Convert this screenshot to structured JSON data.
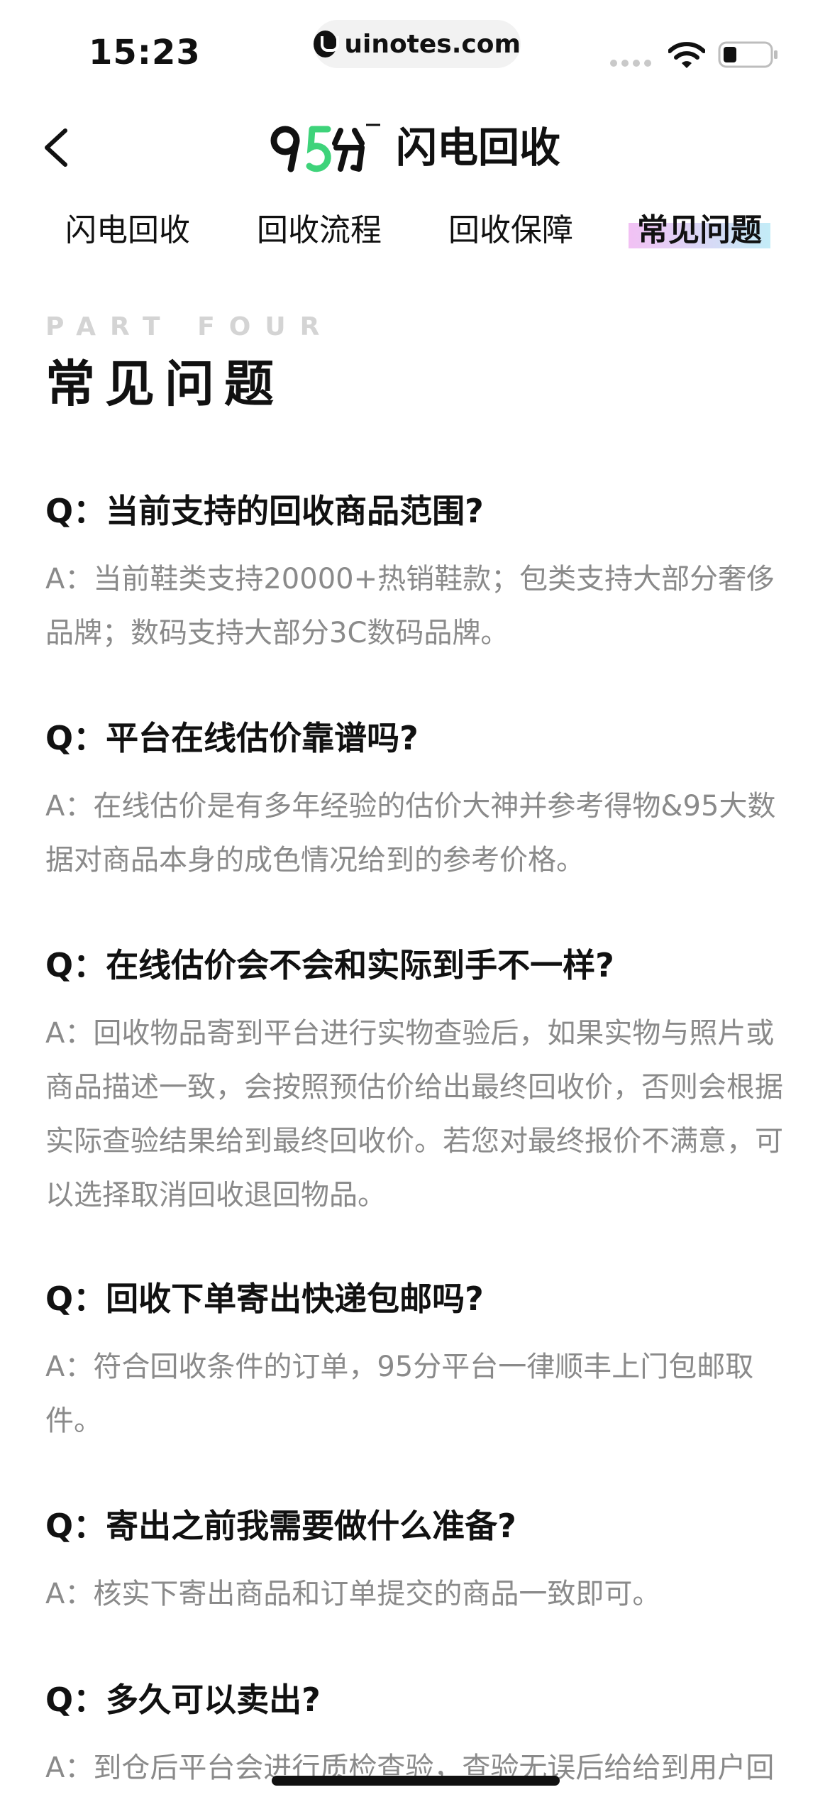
{
  "status": {
    "time": "15:23",
    "url": "uinotes.com"
  },
  "nav": {
    "brand_title": "闪电回收"
  },
  "tabs": [
    {
      "label": "闪电回收"
    },
    {
      "label": "回收流程"
    },
    {
      "label": "回收保障"
    },
    {
      "label": "常见问题",
      "active": true
    }
  ],
  "section": {
    "part_label": "PART FOUR",
    "title": "常见问题"
  },
  "faq": [
    {
      "q": "Q：当前支持的回收商品范围?",
      "a": "A：当前鞋类支持20000+热销鞋款；包类支持大部分奢侈品牌；数码支持大部分3C数码品牌。"
    },
    {
      "q": "Q：平台在线估价靠谱吗?",
      "a": "A：在线估价是有多年经验的估价大神并参考得物&95大数据对商品本身的成色情况给到的参考价格。"
    },
    {
      "q": "Q：在线估价会不会和实际到手不一样?",
      "a": "A：回收物品寄到平台进行实物查验后，如果实物与照片或商品描述一致，会按照预估价给出最终回收价，否则会根据实际查验结果给到最终回收价。若您对最终报价不满意，可以选择取消回收退回物品。"
    },
    {
      "q": "Q：回收下单寄出快递包邮吗?",
      "a": "A：符合回收条件的订单，95分平台一律顺丰上门包邮取件。"
    },
    {
      "q": "Q：寄出之前我需要做什么准备?",
      "a": "A：核实下寄出商品和订单提交的商品一致即可。"
    },
    {
      "q": "Q：多久可以卖出?",
      "a": "A：到仓后平台会进行质检查验，查验无误后给给到用户回"
    }
  ],
  "colors": {
    "accent_gradient_start": "#f2c1f4",
    "accent_gradient_end": "#c3ecf7",
    "logo_green": "#3ed37a"
  }
}
